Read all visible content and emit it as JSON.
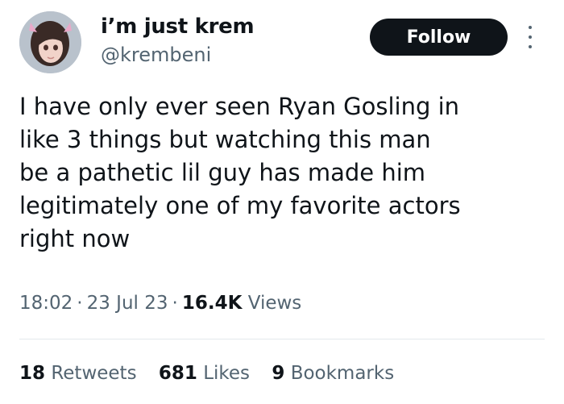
{
  "author": {
    "display_name": "i’m just krem",
    "handle": "@krembeni"
  },
  "actions": {
    "follow_label": "Follow",
    "more_icon": "more-vertical-icon"
  },
  "tweet": {
    "lines": [
      "I have only ever seen Ryan Gosling in",
      "like 3 things but watching this man",
      "be a pathetic lil guy has made him",
      "legitimately one of my favorite actors",
      "right now"
    ]
  },
  "meta": {
    "time": "18:02",
    "date": "23 Jul 23",
    "views_count": "16.4K",
    "views_label": "Views",
    "separator": "·"
  },
  "stats": {
    "retweets_count": "18",
    "retweets_label": "Retweets",
    "likes_count": "681",
    "likes_label": "Likes",
    "bookmarks_count": "9",
    "bookmarks_label": "Bookmarks"
  },
  "colors": {
    "text_primary": "#0f1419",
    "text_secondary": "#536471",
    "button_bg": "#0f1419",
    "divider": "#e4e8ec"
  }
}
